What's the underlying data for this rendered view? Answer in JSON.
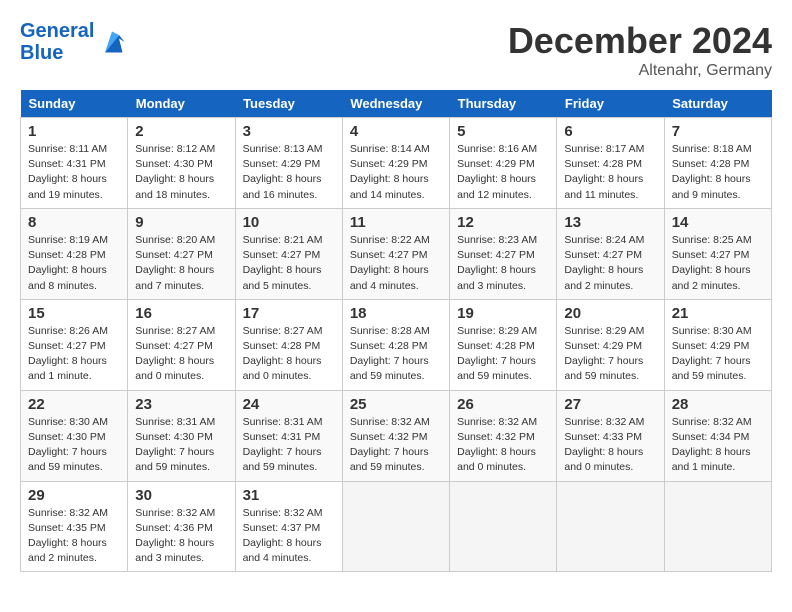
{
  "header": {
    "logo_line1": "General",
    "logo_line2": "Blue",
    "month": "December 2024",
    "location": "Altenahr, Germany"
  },
  "days_of_week": [
    "Sunday",
    "Monday",
    "Tuesday",
    "Wednesday",
    "Thursday",
    "Friday",
    "Saturday"
  ],
  "weeks": [
    [
      {
        "day": "1",
        "info": "Sunrise: 8:11 AM\nSunset: 4:31 PM\nDaylight: 8 hours\nand 19 minutes."
      },
      {
        "day": "2",
        "info": "Sunrise: 8:12 AM\nSunset: 4:30 PM\nDaylight: 8 hours\nand 18 minutes."
      },
      {
        "day": "3",
        "info": "Sunrise: 8:13 AM\nSunset: 4:29 PM\nDaylight: 8 hours\nand 16 minutes."
      },
      {
        "day": "4",
        "info": "Sunrise: 8:14 AM\nSunset: 4:29 PM\nDaylight: 8 hours\nand 14 minutes."
      },
      {
        "day": "5",
        "info": "Sunrise: 8:16 AM\nSunset: 4:29 PM\nDaylight: 8 hours\nand 12 minutes."
      },
      {
        "day": "6",
        "info": "Sunrise: 8:17 AM\nSunset: 4:28 PM\nDaylight: 8 hours\nand 11 minutes."
      },
      {
        "day": "7",
        "info": "Sunrise: 8:18 AM\nSunset: 4:28 PM\nDaylight: 8 hours\nand 9 minutes."
      }
    ],
    [
      {
        "day": "8",
        "info": "Sunrise: 8:19 AM\nSunset: 4:28 PM\nDaylight: 8 hours\nand 8 minutes."
      },
      {
        "day": "9",
        "info": "Sunrise: 8:20 AM\nSunset: 4:27 PM\nDaylight: 8 hours\nand 7 minutes."
      },
      {
        "day": "10",
        "info": "Sunrise: 8:21 AM\nSunset: 4:27 PM\nDaylight: 8 hours\nand 5 minutes."
      },
      {
        "day": "11",
        "info": "Sunrise: 8:22 AM\nSunset: 4:27 PM\nDaylight: 8 hours\nand 4 minutes."
      },
      {
        "day": "12",
        "info": "Sunrise: 8:23 AM\nSunset: 4:27 PM\nDaylight: 8 hours\nand 3 minutes."
      },
      {
        "day": "13",
        "info": "Sunrise: 8:24 AM\nSunset: 4:27 PM\nDaylight: 8 hours\nand 2 minutes."
      },
      {
        "day": "14",
        "info": "Sunrise: 8:25 AM\nSunset: 4:27 PM\nDaylight: 8 hours\nand 2 minutes."
      }
    ],
    [
      {
        "day": "15",
        "info": "Sunrise: 8:26 AM\nSunset: 4:27 PM\nDaylight: 8 hours\nand 1 minute."
      },
      {
        "day": "16",
        "info": "Sunrise: 8:27 AM\nSunset: 4:27 PM\nDaylight: 8 hours\nand 0 minutes."
      },
      {
        "day": "17",
        "info": "Sunrise: 8:27 AM\nSunset: 4:28 PM\nDaylight: 8 hours\nand 0 minutes."
      },
      {
        "day": "18",
        "info": "Sunrise: 8:28 AM\nSunset: 4:28 PM\nDaylight: 7 hours\nand 59 minutes."
      },
      {
        "day": "19",
        "info": "Sunrise: 8:29 AM\nSunset: 4:28 PM\nDaylight: 7 hours\nand 59 minutes."
      },
      {
        "day": "20",
        "info": "Sunrise: 8:29 AM\nSunset: 4:29 PM\nDaylight: 7 hours\nand 59 minutes."
      },
      {
        "day": "21",
        "info": "Sunrise: 8:30 AM\nSunset: 4:29 PM\nDaylight: 7 hours\nand 59 minutes."
      }
    ],
    [
      {
        "day": "22",
        "info": "Sunrise: 8:30 AM\nSunset: 4:30 PM\nDaylight: 7 hours\nand 59 minutes."
      },
      {
        "day": "23",
        "info": "Sunrise: 8:31 AM\nSunset: 4:30 PM\nDaylight: 7 hours\nand 59 minutes."
      },
      {
        "day": "24",
        "info": "Sunrise: 8:31 AM\nSunset: 4:31 PM\nDaylight: 7 hours\nand 59 minutes."
      },
      {
        "day": "25",
        "info": "Sunrise: 8:32 AM\nSunset: 4:32 PM\nDaylight: 7 hours\nand 59 minutes."
      },
      {
        "day": "26",
        "info": "Sunrise: 8:32 AM\nSunset: 4:32 PM\nDaylight: 8 hours\nand 0 minutes."
      },
      {
        "day": "27",
        "info": "Sunrise: 8:32 AM\nSunset: 4:33 PM\nDaylight: 8 hours\nand 0 minutes."
      },
      {
        "day": "28",
        "info": "Sunrise: 8:32 AM\nSunset: 4:34 PM\nDaylight: 8 hours\nand 1 minute."
      }
    ],
    [
      {
        "day": "29",
        "info": "Sunrise: 8:32 AM\nSunset: 4:35 PM\nDaylight: 8 hours\nand 2 minutes."
      },
      {
        "day": "30",
        "info": "Sunrise: 8:32 AM\nSunset: 4:36 PM\nDaylight: 8 hours\nand 3 minutes."
      },
      {
        "day": "31",
        "info": "Sunrise: 8:32 AM\nSunset: 4:37 PM\nDaylight: 8 hours\nand 4 minutes."
      },
      null,
      null,
      null,
      null
    ]
  ]
}
